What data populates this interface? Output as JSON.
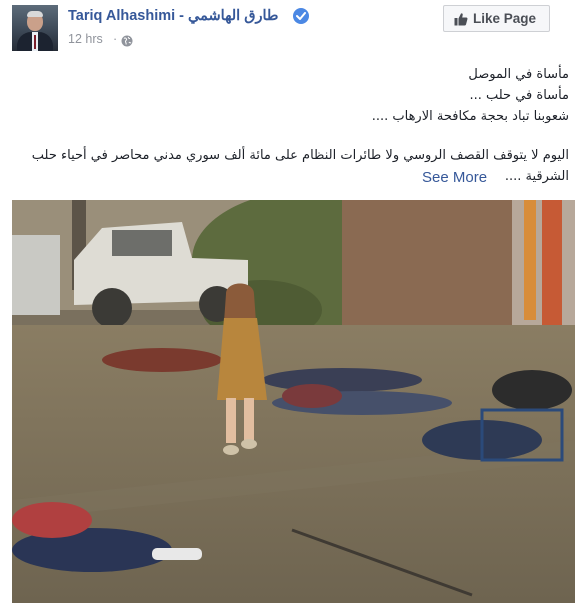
{
  "post": {
    "author": "Tariq Alhashimi - طارق الهاشمي",
    "timestamp": "12 hrs",
    "separator": "·",
    "like_button_label": "Like Page",
    "lines": [
      "مأساة في الموصل",
      "مأساة في حلب ...",
      "شعوبنا تباد بحجة مكافحة الارهاب ...."
    ],
    "paragraph": "اليوم لا يتوقف القصف الروسي ولا طائرات النظام على مائة ألف سوري مدني محاصر في أحياء حلب الشرقية ....",
    "see_more": "See More"
  },
  "icons": {
    "verified": "verified-badge-icon",
    "privacy": "globe-icon",
    "like": "thumbs-up-icon"
  },
  "colors": {
    "link": "#365899",
    "muted": "#90949c",
    "verified": "#4b88e4",
    "button_bg": "#f6f7f9"
  }
}
